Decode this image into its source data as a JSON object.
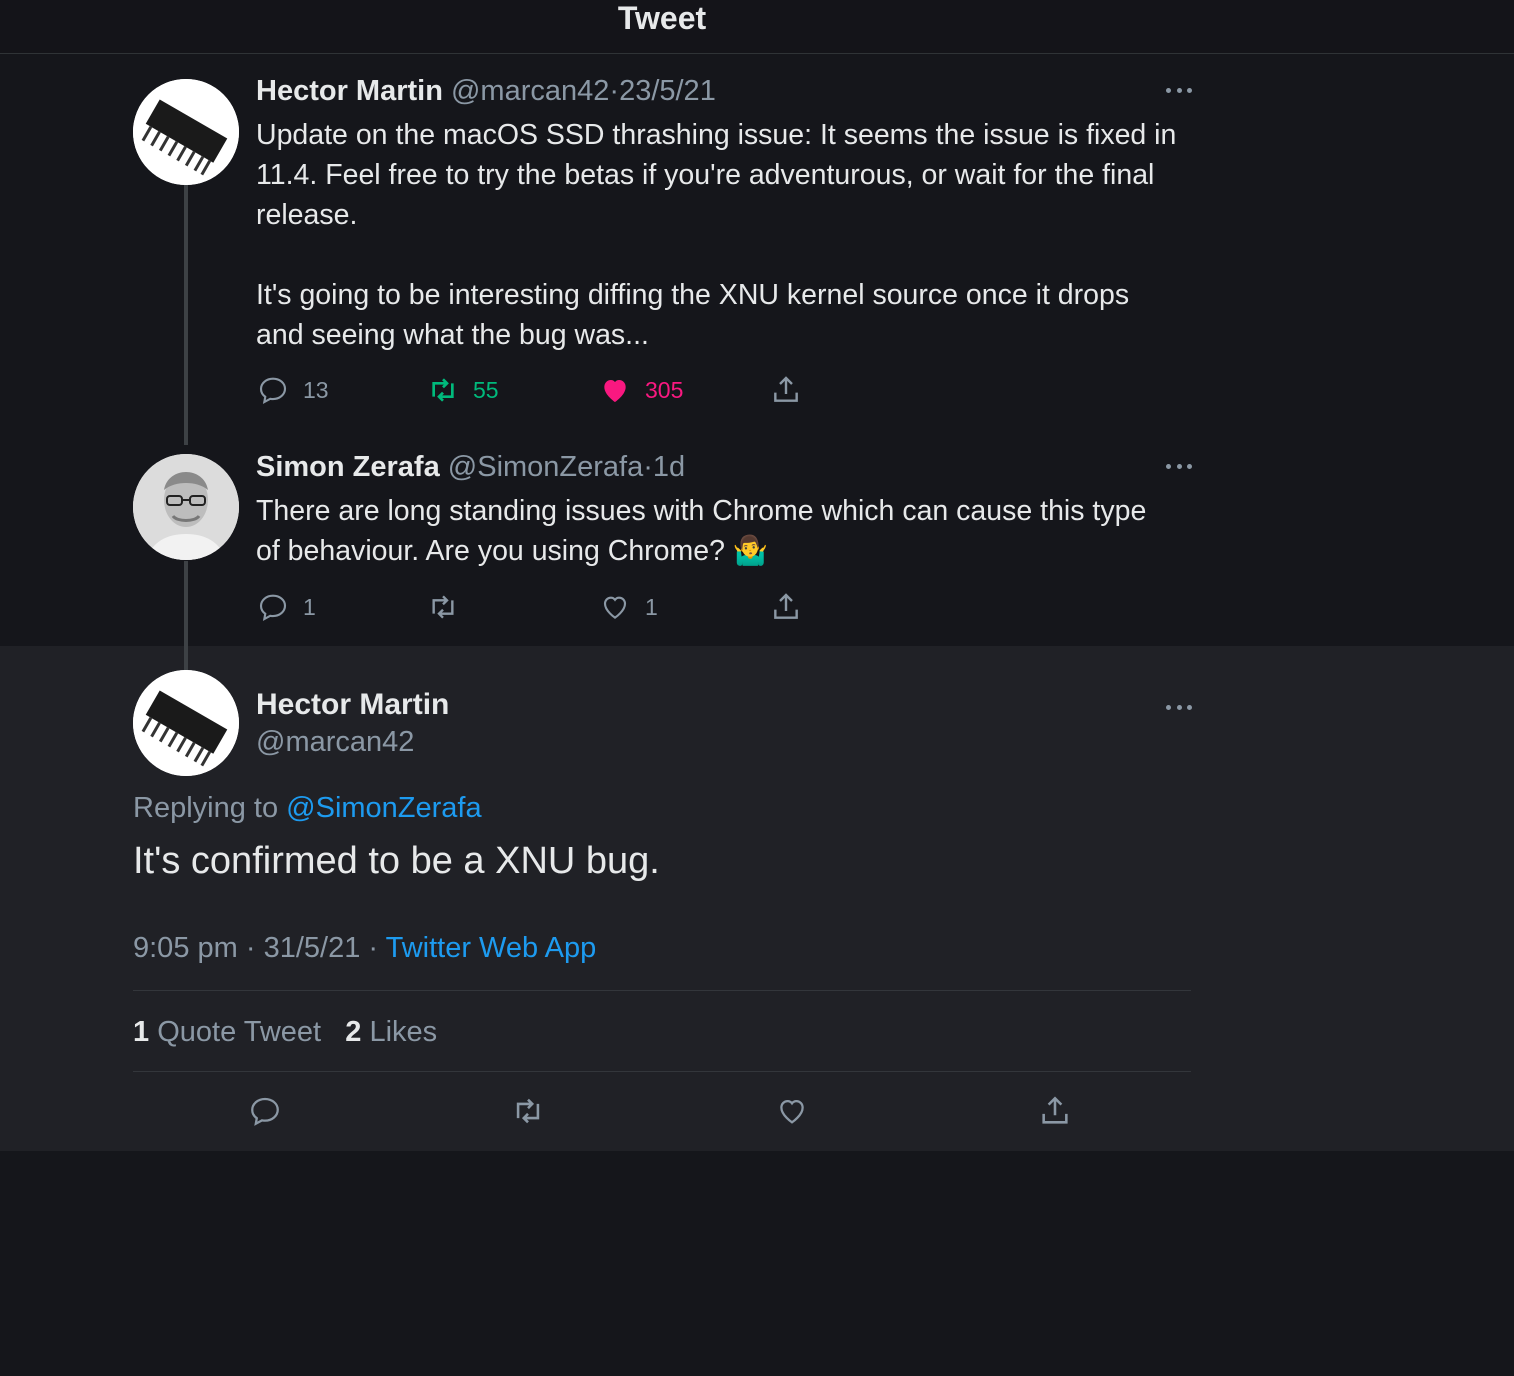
{
  "header": {
    "title": "Tweet"
  },
  "thread": [
    {
      "name": "Hector Martin",
      "handle": "@marcan42",
      "separator": "·",
      "time": "23/5/21",
      "text": "Update on the macOS SSD thrashing issue: It seems the issue is fixed in\n11.4. Feel free to try the betas if you're adventurous, or wait for the final\nrelease.\n\nIt's going to be interesting diffing the XNU kernel source once it drops\nand seeing what the bug was...",
      "replies": "13",
      "retweets": "55",
      "likes": "305"
    },
    {
      "name": "Simon Zerafa",
      "handle": "@SimonZerafa",
      "separator": "·",
      "time": "1d",
      "text": "There are long standing issues with Chrome which can cause this type\nof behaviour. Are you using Chrome? 🤷‍♂️",
      "replies": "1",
      "retweets": "",
      "likes": "1"
    }
  ],
  "focus": {
    "name": "Hector Martin",
    "handle": "@marcan42",
    "replying_prefix": "Replying to ",
    "replying_to": "@SimonZerafa",
    "text": "It's confirmed to be a XNU bug.",
    "time": "9:05 pm",
    "date": "31/5/21",
    "separator": " · ",
    "app": "Twitter Web App",
    "quote_count": "1",
    "quote_label": "Quote Tweet",
    "likes_count": "2",
    "likes_label": "Likes"
  },
  "colors": {
    "background": "#15161b",
    "focus_background": "#202126",
    "accent": "#1d9bf0",
    "retweet_green": "#00ba7c",
    "like_pink": "#f91880",
    "muted": "#8b98a5"
  },
  "icons": [
    "reply-icon",
    "retweet-icon",
    "like-icon",
    "share-icon",
    "more-icon",
    "chip-avatar",
    "person-avatar"
  ]
}
